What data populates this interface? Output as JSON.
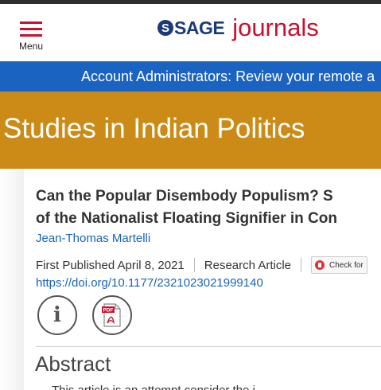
{
  "header": {
    "menu_label": "Menu",
    "logo_mark": "S",
    "logo_sage": "SAGE",
    "logo_journals": "journals"
  },
  "banner": {
    "text": "Account Administrators: Review your remote a"
  },
  "journal": {
    "title": "Studies in Indian Politics"
  },
  "article": {
    "title_line1": "Can the Popular Disembody Populism? S",
    "title_line2": "of the Nationalist Floating Signifier in Con",
    "author": "Jean-Thomas Martelli",
    "first_published": "First Published April 8, 2021",
    "article_type": "Research Article",
    "check_label": "Check for",
    "doi": "https://doi.org/10.1177/2321023021999140",
    "pdf_label": "PDF"
  },
  "abstract": {
    "heading": "Abstract",
    "first_line": "This article is an attempt consider the i..."
  },
  "colors": {
    "brand_red": "#c8102e",
    "brand_blue": "#1b3a7a",
    "banner_blue": "#1a63c0",
    "journal_gold": "#cc8b16",
    "link_blue": "#1565b8"
  },
  "icons": {
    "menu": "hamburger-icon",
    "info": "info-icon",
    "pdf": "pdf-icon",
    "check": "crossmark-icon"
  }
}
